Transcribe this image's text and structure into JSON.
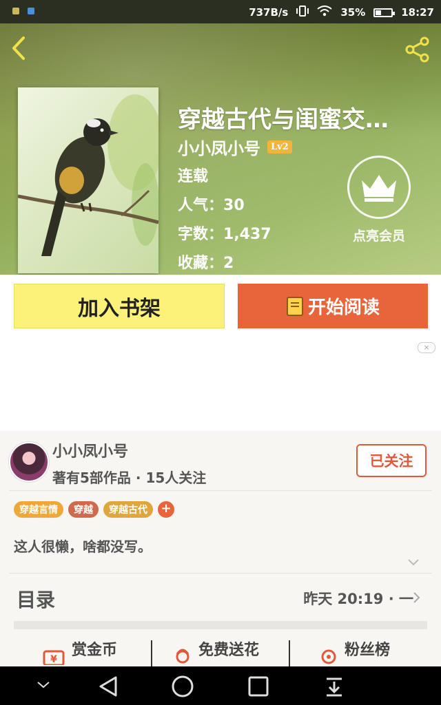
{
  "status_bar": {
    "network_speed": "737B/s",
    "battery_percent": "35%",
    "battery_level": 0.35,
    "time": "18:27"
  },
  "book": {
    "title": "穿越古代与闺蜜交…",
    "author": "小小凤小号",
    "author_level": "Lv2",
    "status": "连载",
    "popularity_label": "人气：",
    "popularity": "30",
    "word_count_label": "字数：",
    "word_count": "1,437",
    "favorites_label": "收藏：",
    "favorites": "2"
  },
  "vip": {
    "label": "点亮会员"
  },
  "actions": {
    "add_shelf": "加入书架",
    "start_reading": "开始阅读"
  },
  "ad": {
    "close": "×"
  },
  "author_card": {
    "name": "小小凤小号",
    "works_prefix": "著有",
    "works_count": "5",
    "works_suffix": "部作品",
    "separator": "·",
    "followers": "15人关注",
    "follow_button": "已关注",
    "tags": [
      {
        "label": "穿越言情",
        "color": "#f0a73a"
      },
      {
        "label": "穿越",
        "color": "#cf6a4c"
      },
      {
        "label": "穿越古代",
        "color": "#e0a53c"
      }
    ],
    "tag_add": "+",
    "bio": "这人很懒，啥都没写。"
  },
  "toc": {
    "label": "目录",
    "updated": "昨天 20:19 · 一"
  },
  "bottom_tabs": {
    "reward": "赏金币",
    "flowers": "免费送花",
    "fans": "粉丝榜"
  },
  "colors": {
    "accent_orange": "#e8643a",
    "shelf_yellow": "#fcf27a",
    "level_badge": "#f2b43a"
  }
}
